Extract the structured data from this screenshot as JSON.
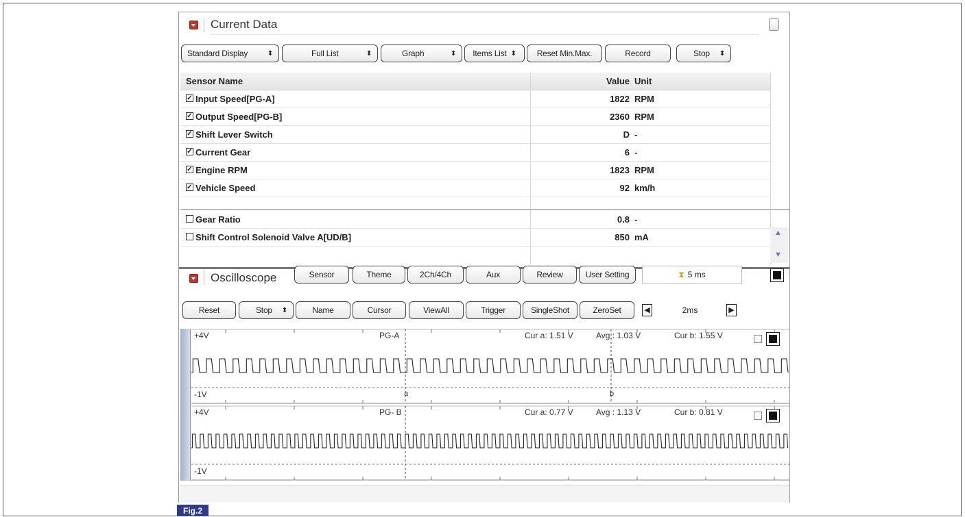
{
  "current_data": {
    "title": "Current Data",
    "toolbar": {
      "standard_display": "Standard Display",
      "full_list": "Full List",
      "graph": "Graph",
      "items_list": "Items List",
      "reset_min_max": "Reset Min.Max.",
      "record": "Record",
      "stop": "Stop",
      "select_arrow": "⬍"
    },
    "table": {
      "headers": {
        "sensor_name": "Sensor Name",
        "value": "Value",
        "unit": "Unit"
      },
      "rows": [
        {
          "checked": true,
          "name": "Input Speed[PG-A]",
          "value": "1822",
          "unit": "RPM"
        },
        {
          "checked": true,
          "name": "Output Speed[PG-B]",
          "value": "2360",
          "unit": "RPM"
        },
        {
          "checked": true,
          "name": "Shift Lever Switch",
          "value": "D",
          "unit": "-"
        },
        {
          "checked": true,
          "name": "Current Gear",
          "value": "6",
          "unit": "-"
        },
        {
          "checked": true,
          "name": "Engine RPM",
          "value": "1823",
          "unit": "RPM"
        },
        {
          "checked": true,
          "name": "Vehicle Speed",
          "value": "92",
          "unit": "km/h"
        },
        {
          "checked": false,
          "name": "Gear Ratio",
          "value": "0.8",
          "unit": "-"
        },
        {
          "checked": false,
          "name": "Shift Control Solenoid Valve A[UD/B]",
          "value": "850",
          "unit": "mA"
        }
      ],
      "check_mark": "✓"
    }
  },
  "oscilloscope": {
    "title": "Oscilloscope",
    "top_buttons": {
      "sensor": "Sensor",
      "theme": "Theme",
      "channels": "2Ch/4Ch",
      "aux": "Aux",
      "review": "Review",
      "user_setting": "User Setting"
    },
    "time_display": "5 ms",
    "control_buttons": {
      "reset": "Reset",
      "stop": "Stop",
      "name": "Name",
      "cursor": "Cursor",
      "view_all": "ViewAll",
      "trigger": "Trigger",
      "single_shot": "SingleShot",
      "zero_set": "ZeroSet"
    },
    "time_scale": "2ms",
    "traces": [
      {
        "name": "PG-A",
        "ymax": "+4V",
        "ymin": "-1V",
        "cur_a": "Cur a: 1.51 V",
        "avg": "Avg : 1.03 V",
        "cur_b": "Cur b: 1.55 V",
        "marker_a": "a",
        "marker_b": "b"
      },
      {
        "name": "PG- B",
        "ymax": "+4V",
        "ymin": "-1V",
        "cur_a": "Cur a: 0.77 V",
        "avg": "Avg : 1.13 V",
        "cur_b": "Cur b: 0.81 V"
      }
    ]
  },
  "figure_label": "Fig.2"
}
